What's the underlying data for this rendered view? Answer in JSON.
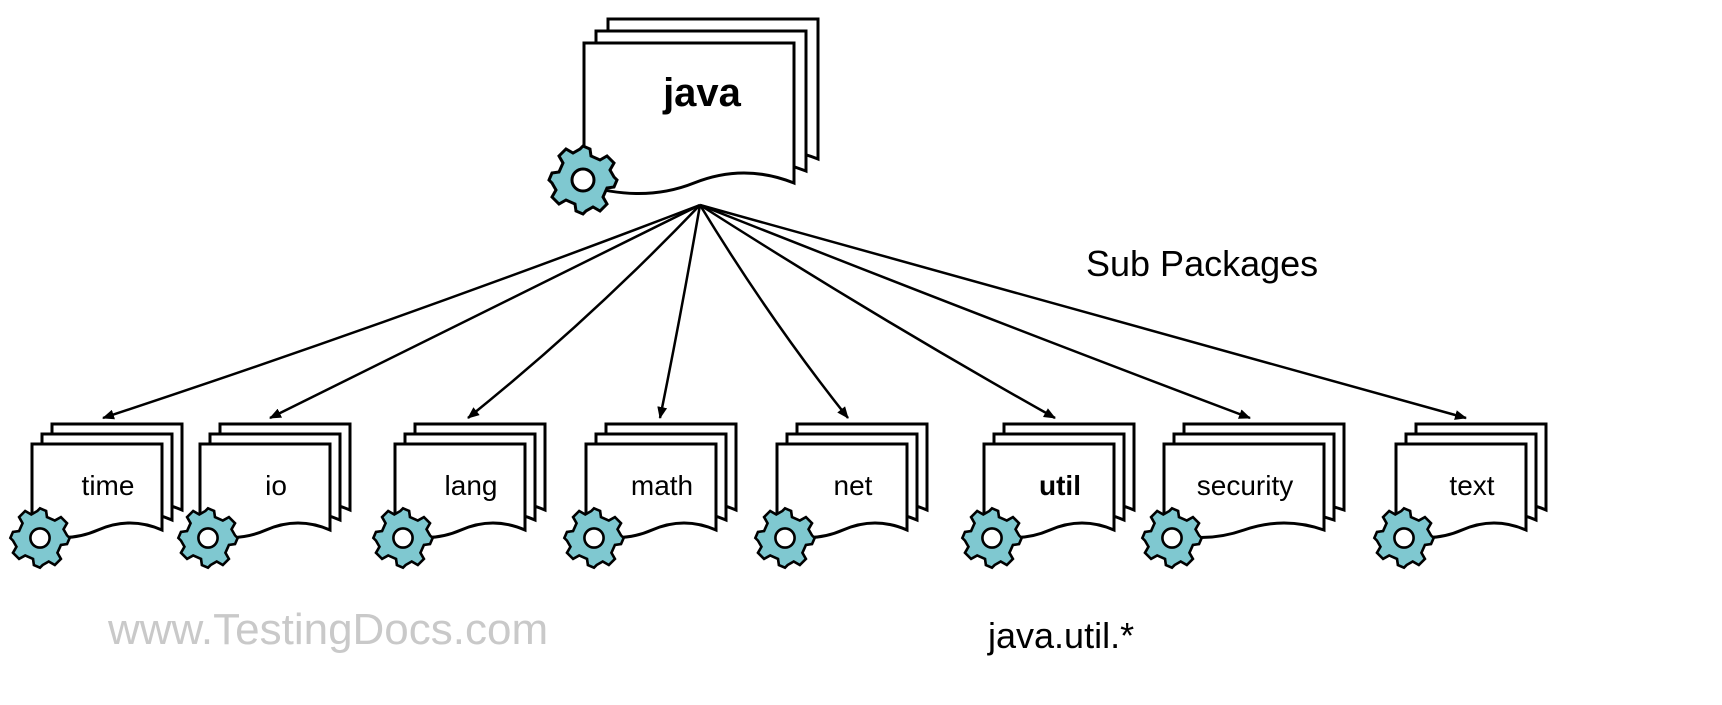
{
  "diagram": {
    "root": {
      "name": "java",
      "bold": true
    },
    "children": [
      {
        "name": "time",
        "bold": false
      },
      {
        "name": "io",
        "bold": false
      },
      {
        "name": "lang",
        "bold": false
      },
      {
        "name": "math",
        "bold": false
      },
      {
        "name": "net",
        "bold": false
      },
      {
        "name": "util",
        "bold": true
      },
      {
        "name": "security",
        "bold": false
      },
      {
        "name": "text",
        "bold": false
      }
    ],
    "annotations": {
      "sub_packages": "Sub Packages",
      "example_path": "java.util.*"
    },
    "watermark": "www.TestingDocs.com",
    "colors": {
      "gear_fill": "#7fc8d0",
      "gear_stroke": "#000000",
      "doc_stroke": "#000000"
    }
  }
}
